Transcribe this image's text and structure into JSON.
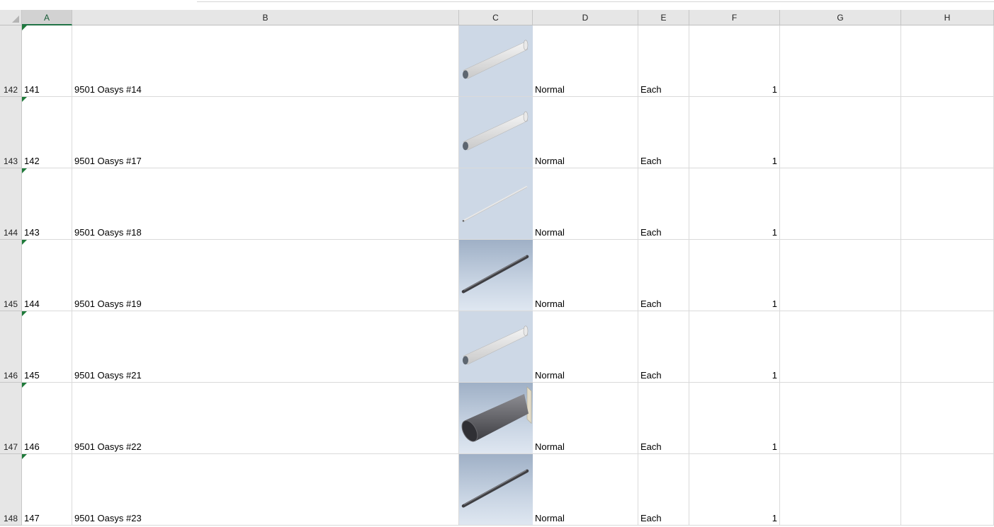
{
  "columns": [
    "A",
    "B",
    "C",
    "D",
    "E",
    "F",
    "G",
    "H"
  ],
  "selected_column": "A",
  "rows": [
    {
      "row_number": "142",
      "a": "141",
      "b": "9501 Oasys #14",
      "d": "Normal",
      "e": "Each",
      "f": "1",
      "thumbnail": "light-pipe-flanged"
    },
    {
      "row_number": "143",
      "a": "142",
      "b": "9501 Oasys #17",
      "d": "Normal",
      "e": "Each",
      "f": "1",
      "thumbnail": "light-pipe-flanged"
    },
    {
      "row_number": "144",
      "a": "143",
      "b": "9501 Oasys #18",
      "d": "Normal",
      "e": "Each",
      "f": "1",
      "thumbnail": "thin-rod"
    },
    {
      "row_number": "145",
      "a": "144",
      "b": "9501 Oasys #19",
      "d": "Normal",
      "e": "Each",
      "f": "1",
      "thumbnail": "dark-rod"
    },
    {
      "row_number": "146",
      "a": "145",
      "b": "9501 Oasys #21",
      "d": "Normal",
      "e": "Each",
      "f": "1",
      "thumbnail": "light-pipe-flanged"
    },
    {
      "row_number": "147",
      "a": "146",
      "b": "9501 Oasys #22",
      "d": "Normal",
      "e": "Each",
      "f": "1",
      "thumbnail": "dark-wide-pipe"
    },
    {
      "row_number": "148",
      "a": "147",
      "b": "9501 Oasys #23",
      "d": "Normal",
      "e": "Each",
      "f": "1",
      "thumbnail": "dark-rod"
    }
  ],
  "colors": {
    "header_bg": "#e6e6e6",
    "selected_accent": "#217346",
    "error_flag": "#1f7a3a"
  }
}
